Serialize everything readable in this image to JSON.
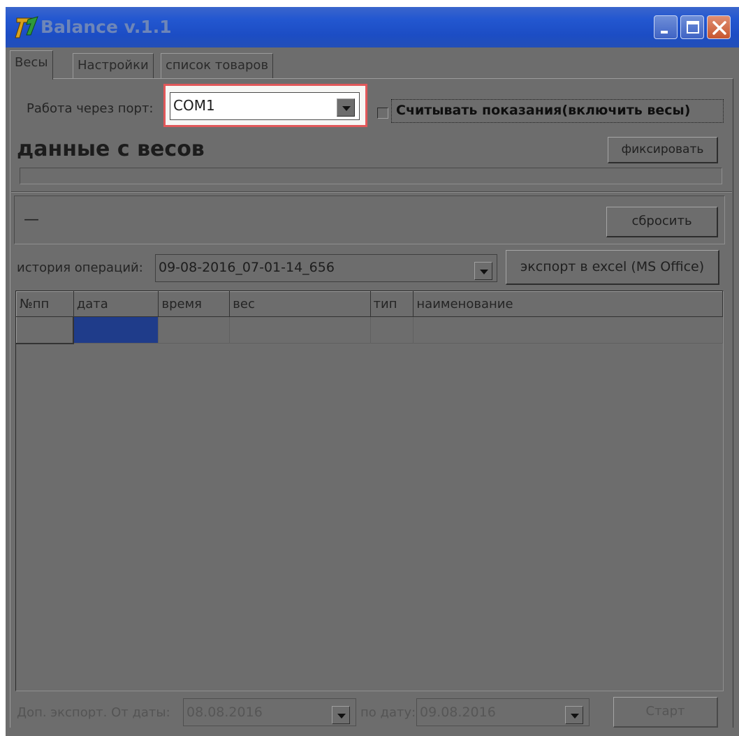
{
  "window": {
    "title": "Balance v.1.1"
  },
  "tabs": [
    {
      "label": "Весы",
      "active": true
    },
    {
      "label": "Настройки",
      "active": false
    },
    {
      "label": "список товаров",
      "active": false
    }
  ],
  "port": {
    "label": "Работа через порт:",
    "value": "COM1",
    "highlight_color": "#e0585a"
  },
  "read_scales": {
    "label": "Считывать показания(включить весы)",
    "checked": false
  },
  "scale_data": {
    "heading": "данные с весов",
    "fix_button": "фиксировать"
  },
  "reading": {
    "value": "—",
    "reset_button": "сбросить"
  },
  "history": {
    "label": "история операций:",
    "value": "09-08-2016_07-01-14_656",
    "export_button": "экспорт в excel (MS Office)"
  },
  "table": {
    "columns": [
      "№пп",
      "дата",
      "время",
      "вес",
      "тип",
      "наименование"
    ],
    "selected_color": "#1f3c8a"
  },
  "extra_export": {
    "label": "Доп. экспорт. От даты:",
    "from_date": "08.08.2016",
    "to_label": "по дату:",
    "to_date": "09.08.2016",
    "start_button": "Старт"
  }
}
